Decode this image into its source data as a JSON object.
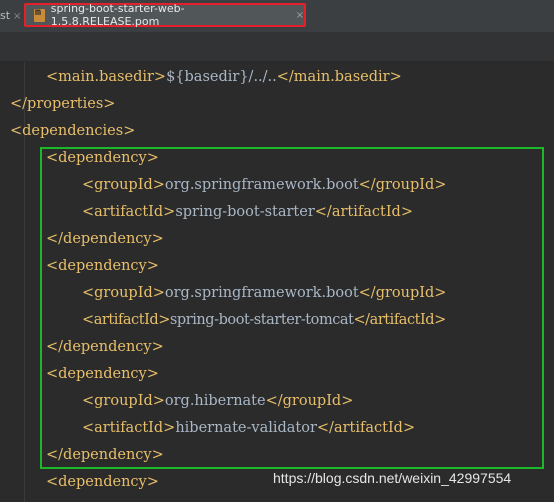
{
  "tabs": {
    "previous_fragment": "st",
    "active_title": "spring-boot-starter-web-1.5.8.RELEASE.pom",
    "close_glyph": "×",
    "file_icon": "maven-pom-file-icon"
  },
  "code_lines": [
    {
      "open": "<main.basedir>",
      "text": "${basedir}/../..",
      "close": "</main.basedir>"
    },
    {
      "open": "",
      "text": "",
      "close": "</properties>"
    },
    {
      "open": "<dependencies>",
      "text": "",
      "close": ""
    },
    {
      "open": "<dependency>",
      "text": "",
      "close": ""
    },
    {
      "open": "<groupId>",
      "text": "org.springframework.boot",
      "close": "</groupId>"
    },
    {
      "open": "<artifactId>",
      "text": "spring-boot-starter",
      "close": "</artifactId>"
    },
    {
      "open": "",
      "text": "",
      "close": "</dependency>"
    },
    {
      "open": "<dependency>",
      "text": "",
      "close": ""
    },
    {
      "open": "<groupId>",
      "text": "org.springframework.boot",
      "close": "</groupId>"
    },
    {
      "open": "<artifactId>",
      "text": "spring-boot-starter-tomcat",
      "close": "</artifactId>"
    },
    {
      "open": "",
      "text": "",
      "close": "</dependency>"
    },
    {
      "open": "<dependency>",
      "text": "",
      "close": ""
    },
    {
      "open": "<groupId>",
      "text": "org.hibernate",
      "close": "</groupId>"
    },
    {
      "open": "<artifactId>",
      "text": "hibernate-validator",
      "close": "</artifactId>"
    },
    {
      "open": "",
      "text": "",
      "close": "</dependency>"
    },
    {
      "open": "<dependency>",
      "text": "",
      "close": ""
    }
  ],
  "watermark": "https://blog.csdn.net/weixin_42997554",
  "colors": {
    "tag": "#e8bf6a",
    "text": "#a9b7c6",
    "red_annotation": "#e4212b",
    "green_annotation": "#1db82a"
  }
}
